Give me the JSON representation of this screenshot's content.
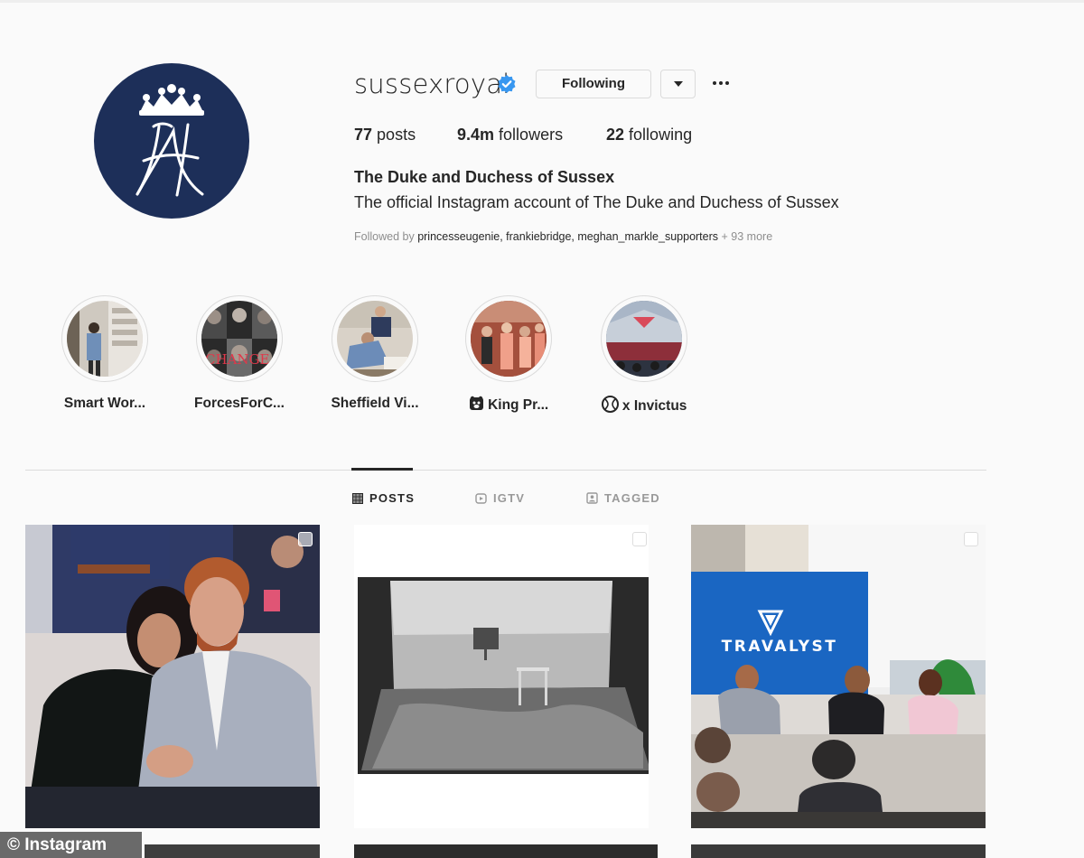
{
  "profile": {
    "username": "sussexroyal",
    "verified": true,
    "follow_button_label": "Following",
    "stats": {
      "posts_count": "77",
      "posts_label": "posts",
      "followers_count": "9.4m",
      "followers_label": "followers",
      "following_count": "22",
      "following_label": "following"
    },
    "full_name": "The Duke and Duchess of Sussex",
    "bio": "The official Instagram account of The Duke and Duchess of Sussex",
    "followed_by": {
      "prefix": "Followed by",
      "names": "princesseugenie, frankiebridge, meghan_markle_supporters",
      "suffix": "+ 93 more"
    },
    "avatar_icon": "royal-crown-monogram"
  },
  "highlights": [
    {
      "label": "Smart Wor..."
    },
    {
      "label": "ForcesForC..."
    },
    {
      "label": "Sheffield Vi..."
    },
    {
      "label": "King Pr...",
      "icon": "bear-icon"
    },
    {
      "label": "x Invictus",
      "icon": "ball-icon"
    }
  ],
  "tabs": [
    {
      "label": "POSTS",
      "icon": "grid-icon",
      "active": true
    },
    {
      "label": "IGTV",
      "icon": "igtv-icon",
      "active": false
    },
    {
      "label": "TAGGED",
      "icon": "tagged-icon",
      "active": false
    }
  ],
  "posts": [
    {
      "caption": ""
    },
    {
      "caption": ""
    },
    {
      "caption": "TRAVALYST"
    }
  ],
  "watermark": "© Instagram",
  "colors": {
    "avatar_bg": "#1d2f59",
    "verified_blue": "#3897f0",
    "travalyst_screen": "#1a66c2"
  }
}
